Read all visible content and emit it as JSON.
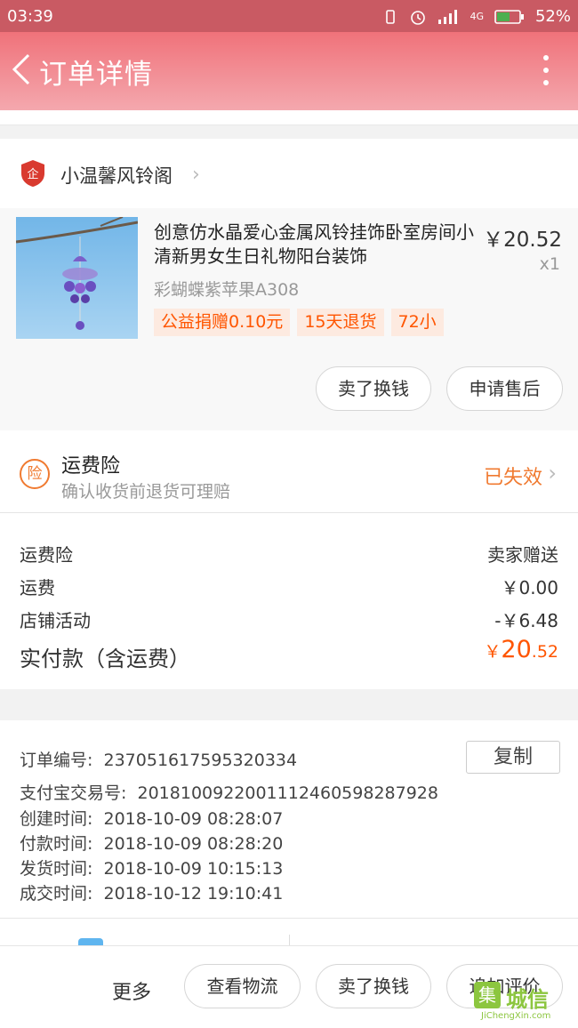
{
  "status_bar": {
    "time": "03:39",
    "battery": "52%",
    "network": "4G"
  },
  "header": {
    "title": "订单详情"
  },
  "shop": {
    "name": "小温馨风铃阁",
    "logo_text": "企"
  },
  "item": {
    "title": "创意仿水晶爱心金属风铃挂饰卧室房间小清新男女生日礼物阳台装饰",
    "price": "￥20.52",
    "quantity": "x1",
    "sku": "彩蝴蝶紫苹果A308",
    "tags": [
      "公益捐赠0.10元",
      "15天退货",
      "72小"
    ],
    "buttons": [
      "卖了换钱",
      "申请售后"
    ]
  },
  "insurance": {
    "badge": "险",
    "title": "运费险",
    "subtitle": "确认收货前退货可理赔",
    "status": "已失效"
  },
  "fees": [
    {
      "label": "运费险",
      "value": "卖家赠送"
    },
    {
      "label": "运费",
      "value": "￥0.00"
    },
    {
      "label": "店铺活动",
      "value": "-￥6.48"
    }
  ],
  "total": {
    "label": "实付款（含运费）",
    "currency": "￥",
    "integer": "20",
    "decimal": ".52"
  },
  "order_info": {
    "copy_button": "复制",
    "lines": [
      {
        "label": "订单编号:",
        "value": "237051617595320334"
      },
      {
        "label": "支付宝交易号:",
        "value": "2018100922001112460598287928"
      },
      {
        "label": "创建时间:",
        "value": "2018-10-09 08:28:07"
      },
      {
        "label": "付款时间:",
        "value": "2018-10-09 08:28:20"
      },
      {
        "label": "发货时间:",
        "value": "2018-10-09 10:15:13"
      },
      {
        "label": "成交时间:",
        "value": "2018-10-12 19:10:41"
      }
    ]
  },
  "bottom_bar": {
    "more": "更多",
    "buttons": [
      "查看物流",
      "卖了换钱",
      "追加评价"
    ]
  },
  "watermark": {
    "box": "集",
    "cn": "城信",
    "en": "JiChengXin.com"
  },
  "colors": {
    "accent": "#ff5500",
    "header_top": "#f0727a",
    "status_bar": "#c95a63"
  }
}
